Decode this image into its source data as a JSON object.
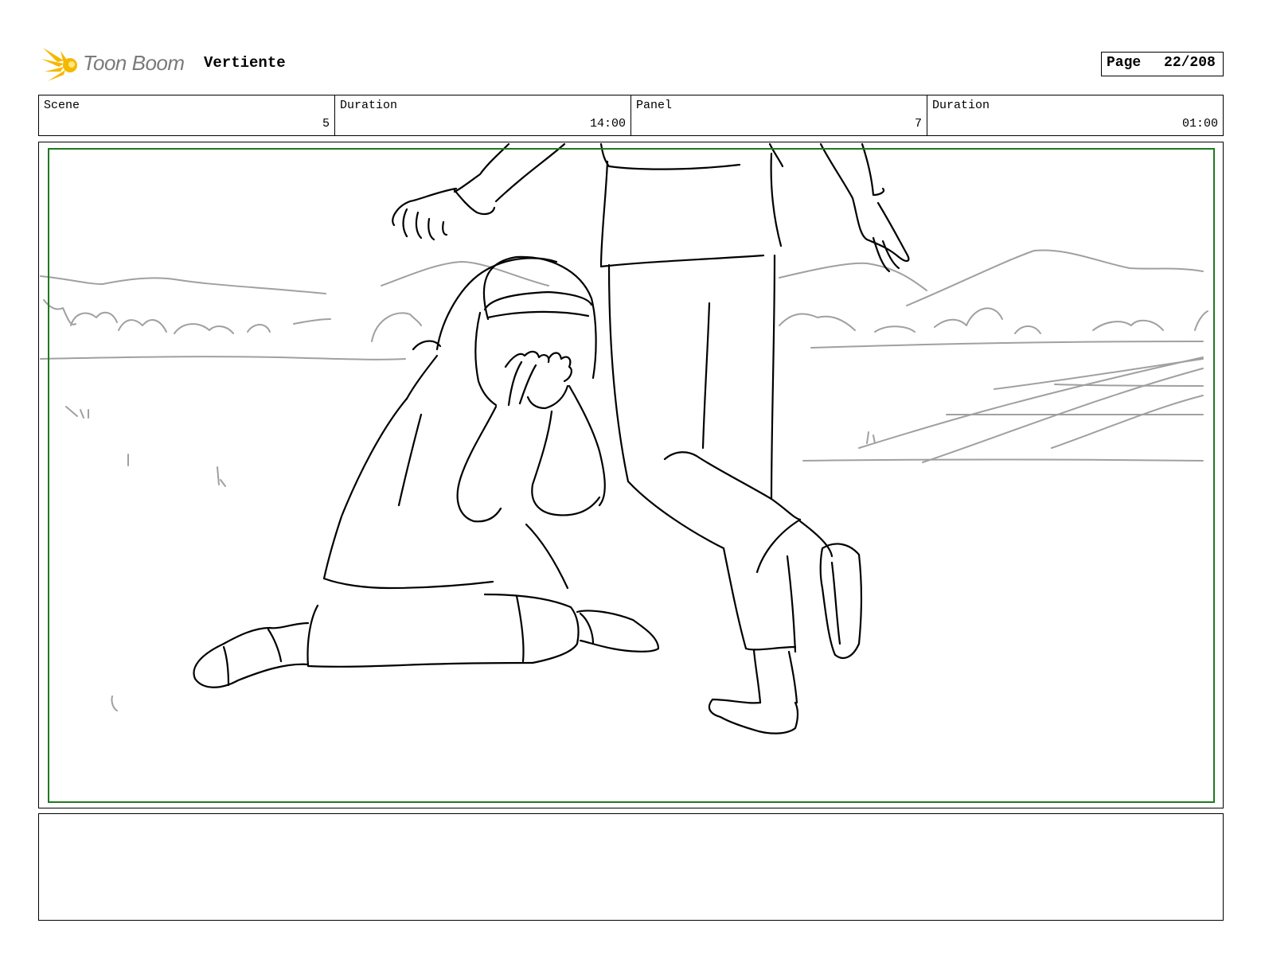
{
  "header": {
    "logo_text": "Toon Boom",
    "project_title": "Vertiente",
    "page_label": "Page",
    "page_number": "22/208"
  },
  "info": {
    "scene_label": "Scene",
    "scene_value": "5",
    "scene_duration_label": "Duration",
    "scene_duration_value": "14:00",
    "panel_label": "Panel",
    "panel_value": "7",
    "panel_duration_label": "Duration",
    "panel_duration_value": "01:00"
  },
  "notes": {
    "text": ""
  },
  "colors": {
    "safe_area": "#1f7a1f",
    "logo_flame": "#f5b800",
    "logo_text": "#7a7a7a"
  },
  "icons": {
    "logo": "toon-boom-flame-icon"
  }
}
